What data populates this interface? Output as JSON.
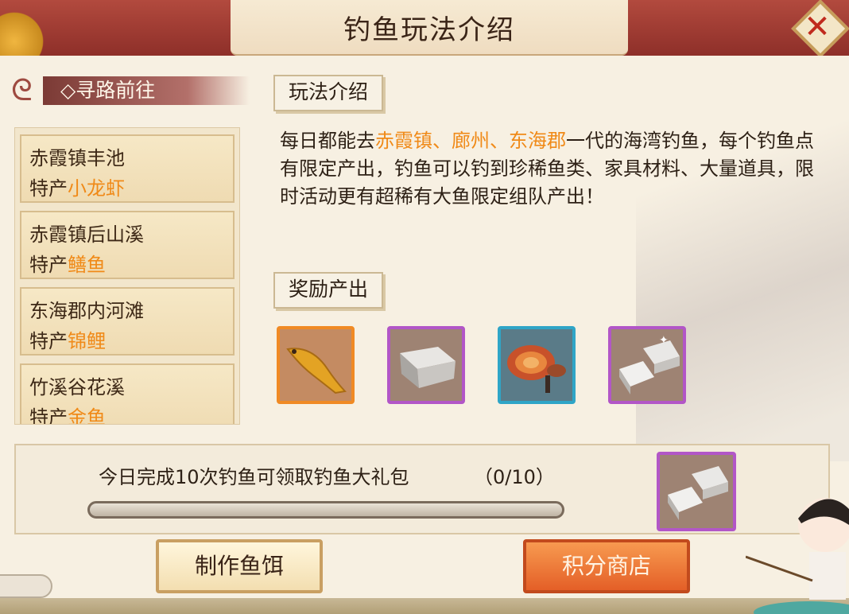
{
  "header": {
    "title": "钓鱼玩法介绍"
  },
  "sidebar": {
    "heading": "◇寻路前往",
    "items": [
      {
        "name": "赤霞镇丰池",
        "spec_prefix": "特产",
        "spec_value": "小龙虾"
      },
      {
        "name": "赤霞镇后山溪",
        "spec_prefix": "特产",
        "spec_value": "鳝鱼"
      },
      {
        "name": "东海郡内河滩",
        "spec_prefix": "特产",
        "spec_value": "锦鲤"
      },
      {
        "name": "竹溪谷花溪",
        "spec_prefix": "特产",
        "spec_value": "金鱼"
      }
    ]
  },
  "intro": {
    "tag": "玩法介绍",
    "text_before": "每日都能去",
    "places": "赤霞镇、廊州、东海郡",
    "text_after": "一代的海湾钓鱼，每个钓鱼点有限定产出，钓鱼可以钓到珍稀鱼类、家具材料、大量道具，限时活动更有超稀有大鱼限定组队产出！"
  },
  "rewards": {
    "tag": "奖励产出",
    "items": [
      {
        "icon": "golden-fish-icon",
        "rarity_color": "#f08a24"
      },
      {
        "icon": "silver-ingot-icon",
        "rarity_color": "#b256c7"
      },
      {
        "icon": "lingzhi-mushroom-icon",
        "rarity_color": "#2fa5c7"
      },
      {
        "icon": "silver-bars-icon",
        "rarity_color": "#b256c7"
      }
    ]
  },
  "daily": {
    "text": "今日完成10次钓鱼可领取钓鱼大礼包",
    "count": "（0/10）",
    "progress": 0,
    "reward_icon": "silver-bars-icon"
  },
  "buttons": {
    "make_bait": "制作鱼饵",
    "points_shop": "积分商店"
  }
}
